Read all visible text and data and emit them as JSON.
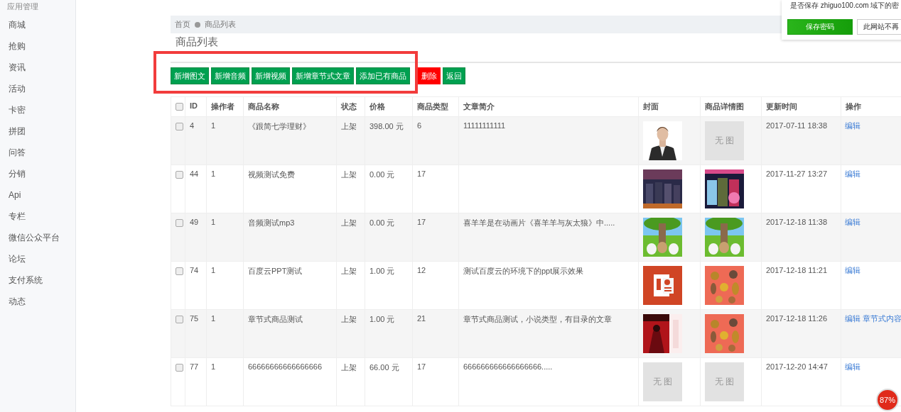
{
  "sidebar": {
    "heading": "应用管理",
    "items": [
      {
        "label": "商城"
      },
      {
        "label": "抢购"
      },
      {
        "label": "资讯"
      },
      {
        "label": "活动"
      },
      {
        "label": "卡密"
      },
      {
        "label": "拼团"
      },
      {
        "label": "问答"
      },
      {
        "label": "分销"
      },
      {
        "label": "Api"
      },
      {
        "label": "专栏"
      },
      {
        "label": "微信公众平台"
      },
      {
        "label": "论坛"
      },
      {
        "label": "支付系统"
      },
      {
        "label": "动态"
      }
    ]
  },
  "breadcrumb": [
    "首页",
    "商品列表"
  ],
  "page_title": "商品列表",
  "toolbar": [
    {
      "label": "新增图文",
      "kind": "primary"
    },
    {
      "label": "新增音频",
      "kind": "primary"
    },
    {
      "label": "新增视频",
      "kind": "primary"
    },
    {
      "label": "新增章节式文章",
      "kind": "primary"
    },
    {
      "label": "添加已有商品",
      "kind": "primary"
    },
    {
      "label": "删除",
      "kind": "danger"
    },
    {
      "label": "返回",
      "kind": "primary"
    }
  ],
  "table": {
    "select_all": {
      "checked": false
    },
    "columns": [
      "ID",
      "操作者",
      "商品名称",
      "状态",
      "价格",
      "商品类型",
      "文章简介",
      "封面",
      "商品详情图",
      "更新时间",
      "操作"
    ],
    "rows": [
      {
        "checked": false,
        "id": "4",
        "operator": "1",
        "name": "《跟简七学理财》",
        "status": "上架",
        "price": "398.00 元",
        "type": "6",
        "summary": "11111111111",
        "cover": {
          "kind": "picture"
        },
        "detail": {
          "kind": "empty",
          "text": "无 图"
        },
        "updated": "2017-07-11 18:38",
        "actions": [
          "编辑"
        ]
      },
      {
        "checked": false,
        "id": "44",
        "operator": "1",
        "name": "视频测试免费",
        "status": "上架",
        "price": "0.00 元",
        "type": "17",
        "summary": "",
        "cover": {
          "kind": "picture"
        },
        "detail": {
          "kind": "picture"
        },
        "updated": "2017-11-27 13:27",
        "actions": [
          "编辑"
        ]
      },
      {
        "checked": false,
        "id": "49",
        "operator": "1",
        "name": "音频测试mp3",
        "status": "上架",
        "price": "0.00 元",
        "type": "17",
        "summary": "喜羊羊是在动画片《喜羊羊与灰太狼》中.....",
        "cover": {
          "kind": "picture"
        },
        "detail": {
          "kind": "picture"
        },
        "updated": "2017-12-18 11:38",
        "actions": [
          "编辑"
        ]
      },
      {
        "checked": false,
        "id": "74",
        "operator": "1",
        "name": "百度云PPT测试",
        "status": "上架",
        "price": "1.00 元",
        "type": "12",
        "summary": "测试百度云的环境下的ppt展示效果",
        "cover": {
          "kind": "picture"
        },
        "detail": {
          "kind": "picture"
        },
        "updated": "2017-12-18 11:21",
        "actions": [
          "编辑"
        ]
      },
      {
        "checked": false,
        "id": "75",
        "operator": "1",
        "name": "章节式商品测试",
        "status": "上架",
        "price": "1.00 元",
        "type": "21",
        "summary": "章节式商品测试，小说类型，有目录的文章",
        "cover": {
          "kind": "picture"
        },
        "detail": {
          "kind": "picture"
        },
        "updated": "2017-12-18 11:26",
        "actions": [
          "编辑",
          "章节式内容"
        ]
      },
      {
        "checked": false,
        "id": "77",
        "operator": "1",
        "name": "66666666666666666",
        "status": "上架",
        "price": "66.00 元",
        "type": "17",
        "summary": "666666666666666666.....",
        "cover": {
          "kind": "empty",
          "text": "无 图"
        },
        "detail": {
          "kind": "empty",
          "text": "无 图"
        },
        "updated": "2017-12-20 14:47",
        "actions": [
          "编辑"
        ]
      }
    ]
  },
  "password_prompt": {
    "message": "是否保存 zhiguo100.com 域下的密",
    "buttons": [
      {
        "label": "保存密码",
        "kind": "primary"
      },
      {
        "label": "此网站不再",
        "kind": "plain"
      }
    ]
  },
  "zoom_badge": "87%",
  "annotation": {
    "kind": "highlight"
  }
}
